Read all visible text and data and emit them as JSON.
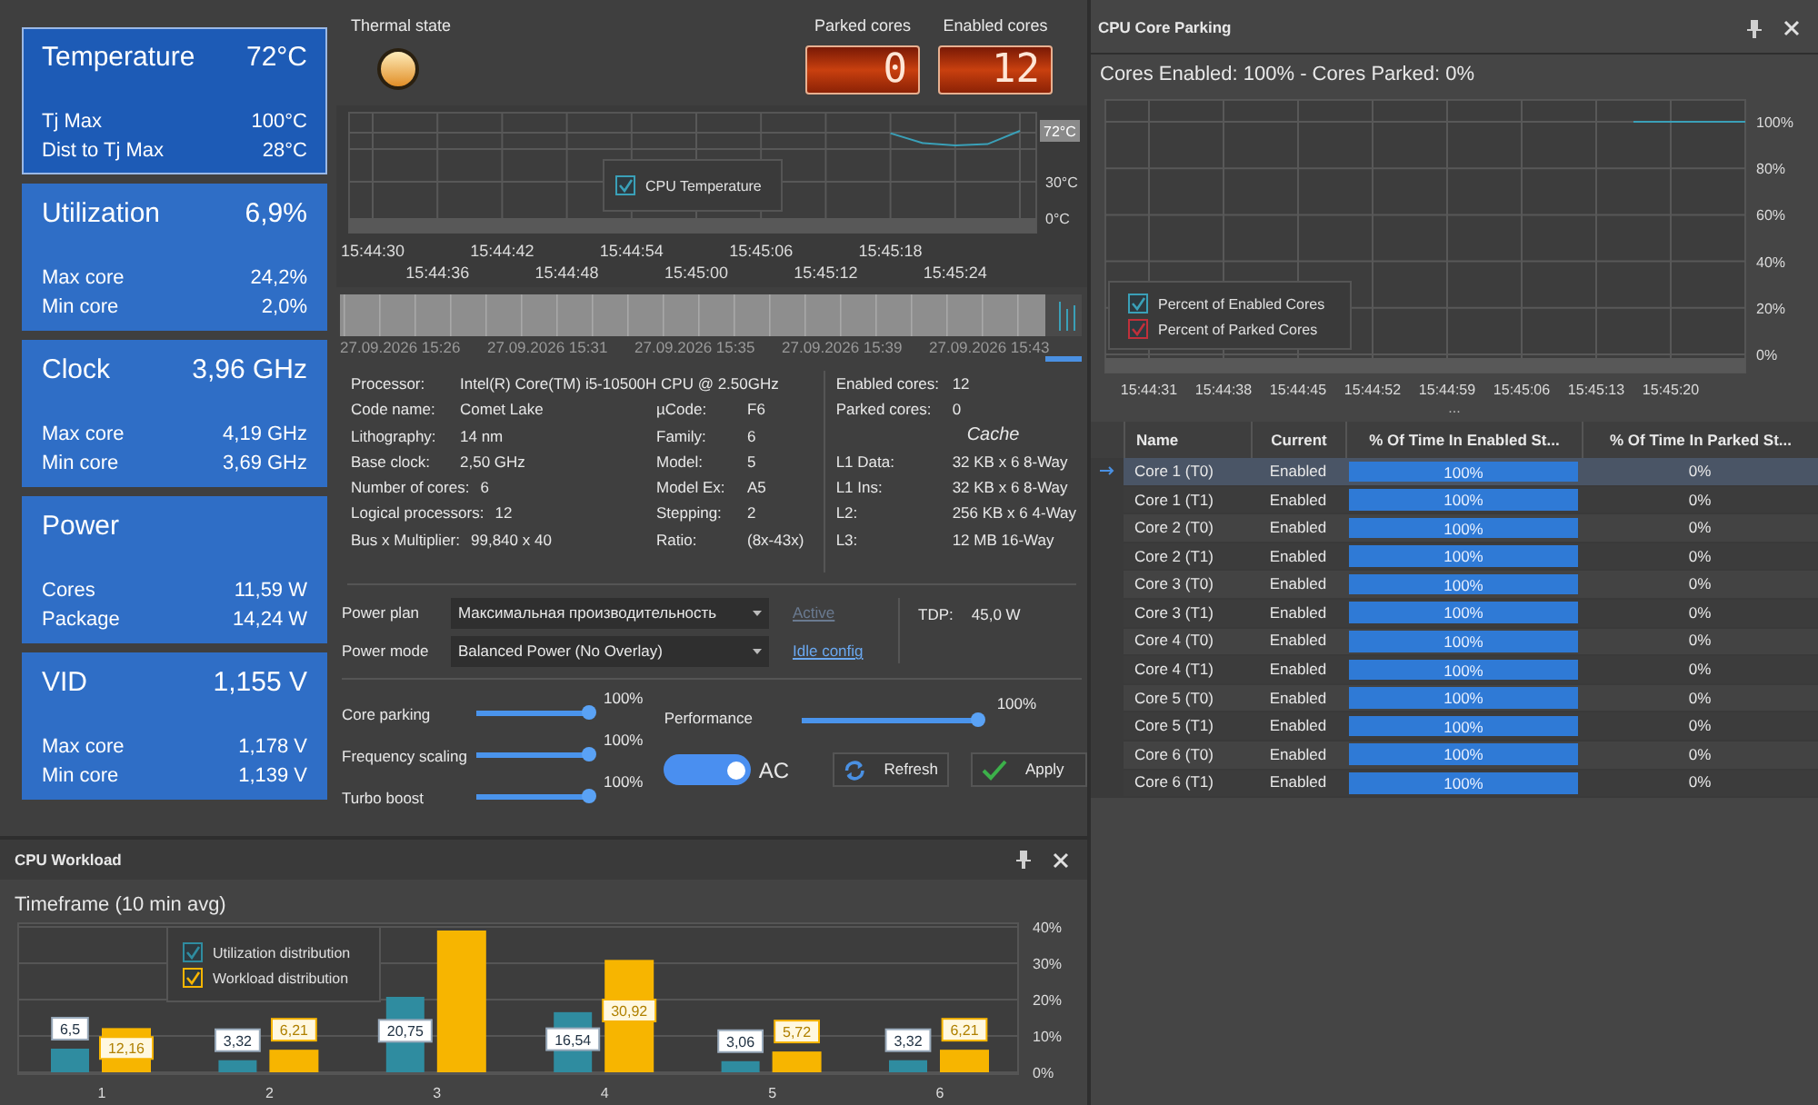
{
  "tiles": [
    {
      "title": "Temperature",
      "value": "72°C",
      "selected": true,
      "rows": [
        {
          "label": "Tj Max",
          "value": "100°C"
        },
        {
          "label": "Dist to Tj Max",
          "value": "28°C"
        }
      ]
    },
    {
      "title": "Utilization",
      "value": "6,9%",
      "selected": false,
      "rows": [
        {
          "label": "Max core",
          "value": "24,2%"
        },
        {
          "label": "Min core",
          "value": "2,0%"
        }
      ]
    },
    {
      "title": "Clock",
      "value": "3,96 GHz",
      "selected": false,
      "rows": [
        {
          "label": "Max core",
          "value": "4,19 GHz"
        },
        {
          "label": "Min core",
          "value": "3,69 GHz"
        }
      ]
    },
    {
      "title": "Power",
      "selected": false,
      "rows": [
        {
          "label": "Cores",
          "value": "11,59 W"
        },
        {
          "label": "Package",
          "value": "14,24 W"
        }
      ]
    },
    {
      "title": "VID",
      "value": "1,155 V",
      "selected": false,
      "rows": [
        {
          "label": "Max core",
          "value": "1,178 V"
        },
        {
          "label": "Min core",
          "value": "1,139 V"
        }
      ]
    }
  ],
  "thermal_state": {
    "label": "Thermal state"
  },
  "counters": [
    {
      "label": "Parked cores",
      "value": "0"
    },
    {
      "label": "Enabled cores",
      "value": "12"
    }
  ],
  "temperature_chart": {
    "legend_items": [
      {
        "checked": true
      }
    ],
    "current_reading": "72°C",
    "chart_data": {
      "type": "line",
      "grid": true,
      "legend": "center",
      "categories": [
        "15:44:30",
        null,
        "15:44:36",
        null,
        "15:44:42",
        null,
        "15:44:48",
        null,
        "15:44:54",
        null,
        "15:45:00",
        null,
        "15:45:06",
        null,
        "15:45:12",
        null,
        "15:45:18",
        null,
        "15:45:24",
        null,
        null
      ],
      "series": [
        {
          "name": "CPU Temperature",
          "color": "#3aa0b8",
          "values": [
            null,
            null,
            null,
            null,
            null,
            null,
            null,
            null,
            null,
            null,
            null,
            null,
            null,
            null,
            null,
            null,
            70,
            62,
            60,
            61,
            72
          ]
        }
      ],
      "ylim": [
        0,
        75
      ],
      "yticks": [
        {
          "value": 0,
          "label": "0°C"
        },
        {
          "value": 30,
          "label": "30°C"
        }
      ]
    }
  },
  "timeline": {
    "labels": [
      "27.09.2026 15:26",
      "27.09.2026 15:31",
      "27.09.2026 15:35",
      "27.09.2026 15:39",
      "27.09.2026 15:43"
    ]
  },
  "processor_info": {
    "columns": [
      [
        {
          "label": "Processor:",
          "value": "Intel(R) Core(TM) i5-10500H CPU @ 2.50GHz"
        },
        {
          "label": "Code name:",
          "value": "Comet Lake"
        },
        {
          "label": "Lithography:",
          "value": "14 nm"
        },
        {
          "label": "Base clock:",
          "value": "2,50 GHz"
        },
        {
          "label": "Number of cores:",
          "value": "6"
        },
        {
          "label": "Logical processors:",
          "value": "12"
        },
        {
          "label": "Bus x Multiplier:",
          "value": "99,840 x 40"
        }
      ],
      [
        {
          "label": "µCode:",
          "value": "F6"
        },
        {
          "label": "Family:",
          "value": "6"
        },
        {
          "label": "Model:",
          "value": "5"
        },
        {
          "label": "Model Ex:",
          "value": "A5"
        },
        {
          "label": "Stepping:",
          "value": "2"
        },
        {
          "label": "Ratio:",
          "value": "(8x-43x)"
        }
      ],
      [
        {
          "kind": "field",
          "label": "Enabled cores:",
          "value": "12"
        },
        {
          "kind": "field",
          "label": "Parked cores:",
          "value": "0"
        },
        {
          "kind": "heading",
          "label": "Cache"
        },
        {
          "kind": "field",
          "label": "L1 Data:",
          "value": "32 KB x 6  8-Way"
        },
        {
          "kind": "field",
          "label": "L1 Ins:",
          "value": "32 KB x 6  8-Way"
        },
        {
          "kind": "field",
          "label": "L2:",
          "value": "256 KB x 6  4-Way"
        },
        {
          "kind": "field",
          "label": "L3:",
          "value": "12 MB  16-Way"
        }
      ]
    ]
  },
  "power": {
    "plan": {
      "label": "Power plan",
      "value": "Максимальная производительность"
    },
    "plan_status": {
      "text": "Active",
      "disabled": true
    },
    "mode": {
      "label": "Power mode",
      "value": "Balanced Power (No Overlay)"
    },
    "idle_config": "Idle config",
    "tdp": {
      "label": "TDP:",
      "value": "45,0 W"
    }
  },
  "sliders": [
    {
      "label": "Core parking",
      "level": 1,
      "reading": "100%"
    },
    {
      "label": "Frequency scaling",
      "level": 1,
      "reading": "100%"
    },
    {
      "label": "Turbo boost",
      "level": 1,
      "reading": "100%"
    }
  ],
  "performance": {
    "label": "Performance",
    "level": 1,
    "reading": "100%"
  },
  "ac_toggle": {
    "label": "AC",
    "on": true
  },
  "buttons": [
    {
      "kind": "refresh",
      "label": "Refresh"
    },
    {
      "kind": "apply",
      "label": "Apply"
    }
  ],
  "workload_panel": {
    "title": "CPU Workload",
    "subtitle": "Timeframe (10 min avg)",
    "legend_items": [
      {
        "checked": true
      },
      {
        "checked": true
      }
    ],
    "chart_data": {
      "type": "bar",
      "grid": true,
      "legend": "upper center",
      "categories": [
        "1",
        "2",
        "3",
        "4",
        "5",
        "6"
      ],
      "series": [
        {
          "name": "Utilization distribution",
          "color": "#2f8ca0",
          "values": [
            6.5,
            3.32,
            20.75,
            16.54,
            3.06,
            3.32
          ],
          "value_labels": [
            "6,5",
            "3,32",
            "20,75",
            "16,54",
            "3,06",
            "3,32"
          ]
        },
        {
          "name": "Workload distribution",
          "color": "#f7b500",
          "values": [
            12.16,
            6.21,
            39,
            30.92,
            5.72,
            6.21
          ],
          "value_labels": [
            "12,16",
            "6,21",
            null,
            "30,92",
            "5,72",
            "6,21"
          ]
        }
      ],
      "ylim": [
        0,
        40
      ],
      "yticks": [
        {
          "value": 0,
          "label": "0%"
        },
        {
          "value": 10,
          "label": "10%"
        },
        {
          "value": 20,
          "label": "20%"
        },
        {
          "value": 30,
          "label": "30%"
        },
        {
          "value": 40,
          "label": "40%"
        }
      ]
    }
  },
  "core_parking_panel": {
    "title": "CPU Core Parking",
    "summary": "Cores Enabled: 100% - Cores Parked: 0%",
    "legend_items": [
      {
        "checked": true
      },
      {
        "checked": true
      }
    ],
    "chart_data": {
      "type": "line",
      "grid": true,
      "legend": "lower left",
      "categories": [
        "15:44:31",
        null,
        "15:44:38",
        null,
        "15:44:45",
        null,
        "15:44:52",
        null,
        "15:44:59",
        null,
        "15:45:06",
        null,
        "15:45:13",
        null,
        "15:45:20",
        null,
        null
      ],
      "series": [
        {
          "name": "Percent of Enabled Cores",
          "color": "#3aa0b8",
          "values": [
            null,
            null,
            null,
            null,
            null,
            null,
            null,
            null,
            null,
            null,
            null,
            null,
            null,
            100,
            100,
            100,
            100
          ]
        },
        {
          "name": "Percent of Parked Cores",
          "color": "#c0303a",
          "values": [
            null,
            null,
            null,
            null,
            null,
            null,
            null,
            null,
            null,
            null,
            null,
            null,
            null,
            null,
            null,
            null,
            null
          ]
        }
      ],
      "ylim": [
        0,
        100
      ],
      "yticks": [
        {
          "value": 0,
          "label": "0%"
        },
        {
          "value": 20,
          "label": "20%"
        },
        {
          "value": 40,
          "label": "40%"
        },
        {
          "value": 60,
          "label": "60%"
        },
        {
          "value": 80,
          "label": "80%"
        },
        {
          "value": 100,
          "label": "100%"
        }
      ]
    },
    "grip": "...",
    "table": {
      "columns": [
        "Name",
        "Current",
        "% Of Time In Enabled St...",
        "% Of Time In Parked St..."
      ],
      "rows": [
        {
          "selected": true,
          "name": "Core 1 (T0)",
          "current": "Enabled",
          "level": 1,
          "enabled": "100%",
          "parked": "0%"
        },
        {
          "selected": false,
          "name": "Core 1 (T1)",
          "current": "Enabled",
          "level": 1,
          "enabled": "100%",
          "parked": "0%"
        },
        {
          "selected": false,
          "name": "Core 2 (T0)",
          "current": "Enabled",
          "level": 1,
          "enabled": "100%",
          "parked": "0%"
        },
        {
          "selected": false,
          "name": "Core 2 (T1)",
          "current": "Enabled",
          "level": 1,
          "enabled": "100%",
          "parked": "0%"
        },
        {
          "selected": false,
          "name": "Core 3 (T0)",
          "current": "Enabled",
          "level": 1,
          "enabled": "100%",
          "parked": "0%"
        },
        {
          "selected": false,
          "name": "Core 3 (T1)",
          "current": "Enabled",
          "level": 1,
          "enabled": "100%",
          "parked": "0%"
        },
        {
          "selected": false,
          "name": "Core 4 (T0)",
          "current": "Enabled",
          "level": 1,
          "enabled": "100%",
          "parked": "0%"
        },
        {
          "selected": false,
          "name": "Core 4 (T1)",
          "current": "Enabled",
          "level": 1,
          "enabled": "100%",
          "parked": "0%"
        },
        {
          "selected": false,
          "name": "Core 5 (T0)",
          "current": "Enabled",
          "level": 1,
          "enabled": "100%",
          "parked": "0%"
        },
        {
          "selected": false,
          "name": "Core 5 (T1)",
          "current": "Enabled",
          "level": 1,
          "enabled": "100%",
          "parked": "0%"
        },
        {
          "selected": false,
          "name": "Core 6 (T0)",
          "current": "Enabled",
          "level": 1,
          "enabled": "100%",
          "parked": "0%"
        },
        {
          "selected": false,
          "name": "Core 6 (T1)",
          "current": "Enabled",
          "level": 1,
          "enabled": "100%",
          "parked": "0%"
        }
      ]
    }
  }
}
